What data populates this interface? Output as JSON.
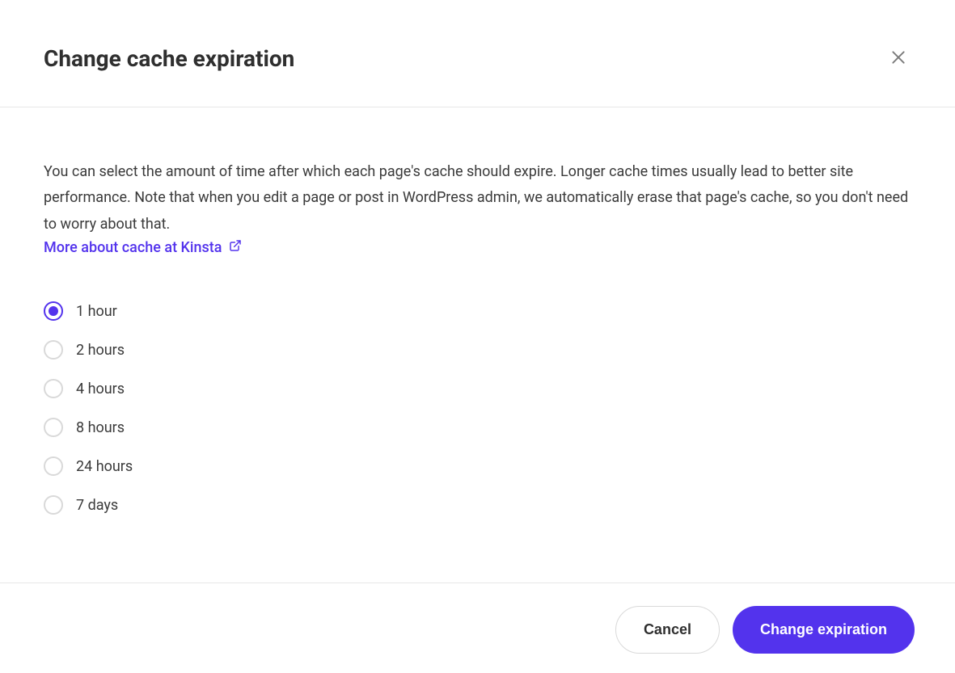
{
  "dialog": {
    "title": "Change cache expiration",
    "description": "You can select the amount of time after which each page's cache should expire. Longer cache times usually lead to better site performance. Note that when you edit a page or post in WordPress admin, we automatically erase that page's cache, so you don't need to worry about that.",
    "link_label": "More about cache at Kinsta",
    "options": [
      {
        "label": "1 hour",
        "selected": true
      },
      {
        "label": "2 hours",
        "selected": false
      },
      {
        "label": "4 hours",
        "selected": false
      },
      {
        "label": "8 hours",
        "selected": false
      },
      {
        "label": "24 hours",
        "selected": false
      },
      {
        "label": "7 days",
        "selected": false
      }
    ],
    "cancel_label": "Cancel",
    "submit_label": "Change expiration"
  },
  "colors": {
    "accent": "#5333ed"
  }
}
